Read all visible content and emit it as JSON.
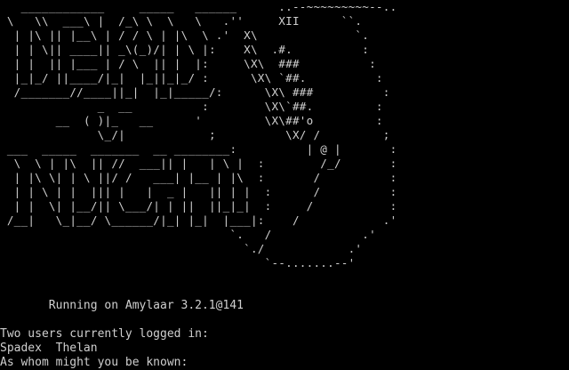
{
  "terminal": {
    "colors": {
      "background": "#000000",
      "foreground": "#cfcfcf"
    },
    "banner_art": [
      "   ____________     _____   ______      ..--~~~~~~~~~--..",
      " \\   \\\\  ___\\ |  /_\\ \\  \\   \\   .''     XII      ``.",
      "  | |\\ || |__\\ | / / \\ | |\\  \\ .'  X\\              `.",
      "  | | \\|| ____|| _\\(_)/| | \\ |:    X\\  .#.          :",
      "  | |  || |___ | / \\  || |  |:     \\X\\  ###          :",
      "  |_|_/ ||____/|_|  |_||_|_/ :      \\X\\ `##.          :",
      "  /_______//____||_|  |_|_____/:      \\X\\ ###          :",
      "              _  __          :        \\X\\`##.         :",
      "        __  ( )|_   __      '         \\X\\##'o         :",
      "              \\_/|            ;          \\X/ /         ;",
      " ___  _____  _______  __ ________:          | @ |       :",
      "  \\  \\ | |\\  || //  ___|| |   | \\ |  :        /_/       :",
      "  | |\\ \\| | \\ ||/ /   ___| |__ | |\\  :       /          :",
      "  | | \\ | |  ||| |   |  _ |   || | |  :      /          :",
      "  | |  \\| |__/|| \\___/| | ||  ||_|_|  :     /           :",
      " /__|   \\_|__/ \\______/|_| |_|  |___|:    /            .'",
      "                                 `.   /             .'",
      "                                   `./            .'",
      "                                      `--.......--'"
    ],
    "status_line": "       Running on Amylaar 3.2.1@141",
    "users_header": "Two users currently logged in:",
    "users": [
      "Spadex",
      "Thelan"
    ],
    "login_prompt": "As whom might you be known:"
  }
}
